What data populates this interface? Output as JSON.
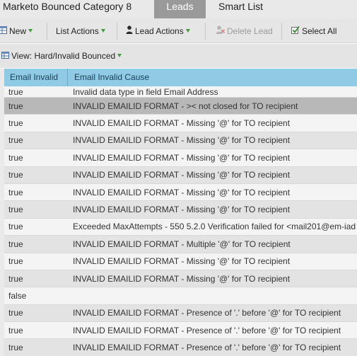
{
  "tabs": {
    "title": "Marketo Bounced Category 8",
    "leads": "Leads",
    "smart_list": "Smart List"
  },
  "toolbar": {
    "new": "New",
    "list_actions": "List Actions",
    "lead_actions": "Lead Actions",
    "delete_lead": "Delete Lead",
    "select_all": "Select All"
  },
  "view": {
    "label": "View: Hard/Invalid Bounced"
  },
  "grid": {
    "columns": [
      "Email Invalid",
      "Email Invalid Cause"
    ],
    "rows": [
      {
        "invalid": "true",
        "cause": "Invalid data type in field Email Address"
      },
      {
        "invalid": "true",
        "cause": "INVALID EMAILID FORMAT - >< not closed for TO recipient"
      },
      {
        "invalid": "true",
        "cause": "INVALID EMAILID FORMAT - Missing '@' for TO recipient"
      },
      {
        "invalid": "true",
        "cause": "INVALID EMAILID FORMAT - Missing '@' for TO recipient"
      },
      {
        "invalid": "true",
        "cause": "INVALID EMAILID FORMAT - Missing '@' for TO recipient"
      },
      {
        "invalid": "true",
        "cause": "INVALID EMAILID FORMAT - Missing '@' for TO recipient"
      },
      {
        "invalid": "true",
        "cause": "INVALID EMAILID FORMAT - Missing '@' for TO recipient"
      },
      {
        "invalid": "true",
        "cause": "INVALID EMAILID FORMAT - Missing '@' for TO recipient"
      },
      {
        "invalid": "true",
        "cause": "Exceeded MaxAttempts - 550 5.2.0 Verification failed for <mail201@em-iad"
      },
      {
        "invalid": "true",
        "cause": "INVALID EMAILID FORMAT - Multiple '@' for TO recipient"
      },
      {
        "invalid": "true",
        "cause": "INVALID EMAILID FORMAT - Missing '@' for TO recipient"
      },
      {
        "invalid": "true",
        "cause": "INVALID EMAILID FORMAT - Missing '@' for TO recipient"
      },
      {
        "invalid": "false",
        "cause": ""
      },
      {
        "invalid": "true",
        "cause": "INVALID EMAILID FORMAT - Presence of '.' before '@' for TO recipient"
      },
      {
        "invalid": "true",
        "cause": "INVALID EMAILID FORMAT - Presence of '.' before '@' for TO recipient"
      },
      {
        "invalid": "true",
        "cause": "INVALID EMAILID FORMAT - Presence of '.' before '@' for TO recipient"
      }
    ]
  }
}
